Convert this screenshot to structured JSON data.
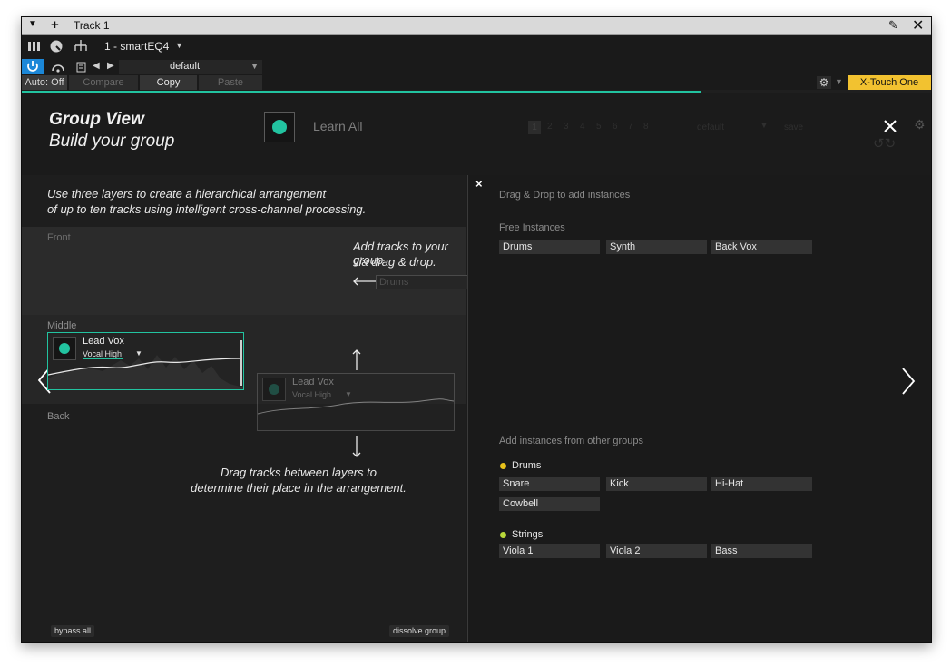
{
  "window": {
    "title": "Track 1",
    "plugin_name": "1 - smartEQ4",
    "preset": "default",
    "auto": "Auto: Off",
    "compare": "Compare",
    "copy": "Copy",
    "paste": "Paste",
    "device": "X-Touch One"
  },
  "header": {
    "title": "Group View",
    "subtitle": "Build your group",
    "learn_all": "Learn All",
    "preset_ghost": "default",
    "save_ghost": "save",
    "pages": [
      "1",
      "2",
      "3",
      "4",
      "5",
      "6",
      "7",
      "8"
    ]
  },
  "left": {
    "intro_line1": "Use three layers to create a hierarchical arrangement",
    "intro_line2": "of up to ten tracks using intelligent cross-channel processing.",
    "front": "Front",
    "middle": "Middle",
    "back": "Back",
    "hint_add1": "Add tracks to your group",
    "hint_add2": "via drag & drop.",
    "ghost_chip": "Drums",
    "track_name": "Lead Vox",
    "track_profile": "Vocal High",
    "ghost_track_name": "Lead Vox",
    "ghost_track_profile": "Vocal High",
    "hint_drag1": "Drag tracks between layers to",
    "hint_drag2": "determine their place in the arrangement.",
    "bypass_all": "bypass all",
    "dissolve_group": "dissolve group"
  },
  "right": {
    "close": "×",
    "dnd_hint": "Drag & Drop to add instances",
    "free_title": "Free Instances",
    "free": [
      "Drums",
      "Synth",
      "Back Vox"
    ],
    "other_title": "Add instances from other groups",
    "groups": [
      {
        "name": "Drums",
        "color": "#e8c21b",
        "items": [
          "Snare",
          "Kick",
          "Hi-Hat",
          "Cowbell"
        ]
      },
      {
        "name": "Strings",
        "color": "#b9d83a",
        "items": [
          "Viola 1",
          "Viola 2",
          "Bass"
        ]
      }
    ]
  },
  "colors": {
    "accent": "#22c3a0",
    "device_badge": "#f2c230",
    "power_button": "#1b87d8"
  }
}
